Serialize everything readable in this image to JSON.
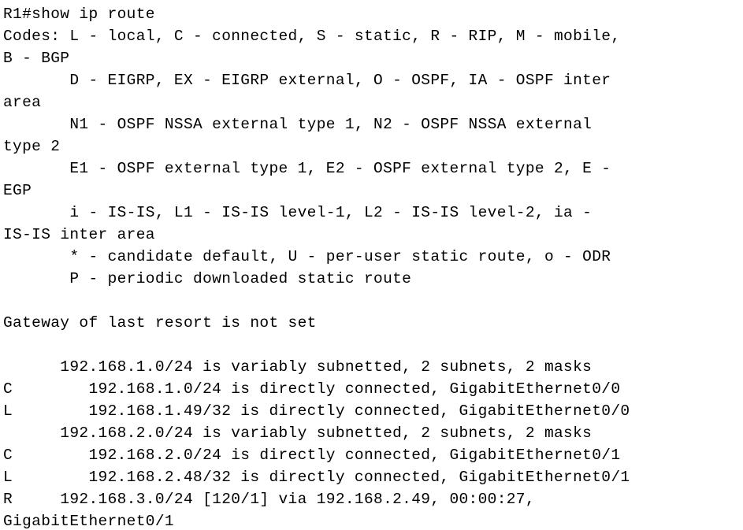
{
  "terminal": {
    "app": "cisco-ios-cli",
    "prompt": "R1#",
    "command": "show ip route",
    "colors": {
      "background": "#ffffff",
      "foreground": "#000000"
    },
    "lines": [
      "R1#show ip route",
      "Codes: L - local, C - connected, S - static, R - RIP, M - mobile,",
      "B - BGP",
      "       D - EIGRP, EX - EIGRP external, O - OSPF, IA - OSPF inter",
      "area",
      "       N1 - OSPF NSSA external type 1, N2 - OSPF NSSA external",
      "type 2",
      "       E1 - OSPF external type 1, E2 - OSPF external type 2, E -",
      "EGP",
      "       i - IS-IS, L1 - IS-IS level-1, L2 - IS-IS level-2, ia -",
      "IS-IS inter area",
      "       * - candidate default, U - per-user static route, o - ODR",
      "       P - periodic downloaded static route",
      "",
      "Gateway of last resort is not set",
      "",
      "      192.168.1.0/24 is variably subnetted, 2 subnets, 2 masks",
      "C        192.168.1.0/24 is directly connected, GigabitEthernet0/0",
      "L        192.168.1.49/32 is directly connected, GigabitEthernet0/0",
      "      192.168.2.0/24 is variably subnetted, 2 subnets, 2 masks",
      "C        192.168.2.0/24 is directly connected, GigabitEthernet0/1",
      "L        192.168.2.48/32 is directly connected, GigabitEthernet0/1",
      "R     192.168.3.0/24 [120/1] via 192.168.2.49, 00:00:27,",
      "GigabitEthernet0/1"
    ],
    "legend": {
      "title": "Codes:",
      "entries": [
        {
          "code": "L",
          "meaning": "local"
        },
        {
          "code": "C",
          "meaning": "connected"
        },
        {
          "code": "S",
          "meaning": "static"
        },
        {
          "code": "R",
          "meaning": "RIP"
        },
        {
          "code": "M",
          "meaning": "mobile"
        },
        {
          "code": "B",
          "meaning": "BGP"
        },
        {
          "code": "D",
          "meaning": "EIGRP"
        },
        {
          "code": "EX",
          "meaning": "EIGRP external"
        },
        {
          "code": "O",
          "meaning": "OSPF"
        },
        {
          "code": "IA",
          "meaning": "OSPF inter area"
        },
        {
          "code": "N1",
          "meaning": "OSPF NSSA external type 1"
        },
        {
          "code": "N2",
          "meaning": "OSPF NSSA external type 2"
        },
        {
          "code": "E1",
          "meaning": "OSPF external type 1"
        },
        {
          "code": "E2",
          "meaning": "OSPF external type 2"
        },
        {
          "code": "E",
          "meaning": "EGP"
        },
        {
          "code": "i",
          "meaning": "IS-IS"
        },
        {
          "code": "L1",
          "meaning": "IS-IS level-1"
        },
        {
          "code": "L2",
          "meaning": "IS-IS level-2"
        },
        {
          "code": "ia",
          "meaning": "IS-IS inter area"
        },
        {
          "code": "*",
          "meaning": "candidate default"
        },
        {
          "code": "U",
          "meaning": "per-user static route"
        },
        {
          "code": "o",
          "meaning": "ODR"
        },
        {
          "code": "P",
          "meaning": "periodic downloaded static route"
        }
      ]
    },
    "gateway_of_last_resort": "Gateway of last resort is not set",
    "routing_table": [
      {
        "parent": "192.168.1.0/24 is variably subnetted, 2 subnets, 2 masks",
        "routes": [
          {
            "code": "C",
            "network": "192.168.1.0/24",
            "detail": "is directly connected, GigabitEthernet0/0"
          },
          {
            "code": "L",
            "network": "192.168.1.49/32",
            "detail": "is directly connected, GigabitEthernet0/0"
          }
        ]
      },
      {
        "parent": "192.168.2.0/24 is variably subnetted, 2 subnets, 2 masks",
        "routes": [
          {
            "code": "C",
            "network": "192.168.2.0/24",
            "detail": "is directly connected, GigabitEthernet0/1"
          },
          {
            "code": "L",
            "network": "192.168.2.48/32",
            "detail": "is directly connected, GigabitEthernet0/1"
          }
        ]
      },
      {
        "parent": "",
        "routes": [
          {
            "code": "R",
            "network": "192.168.3.0/24",
            "detail": "[120/1] via 192.168.2.49, 00:00:27, GigabitEthernet0/1"
          }
        ]
      }
    ]
  }
}
